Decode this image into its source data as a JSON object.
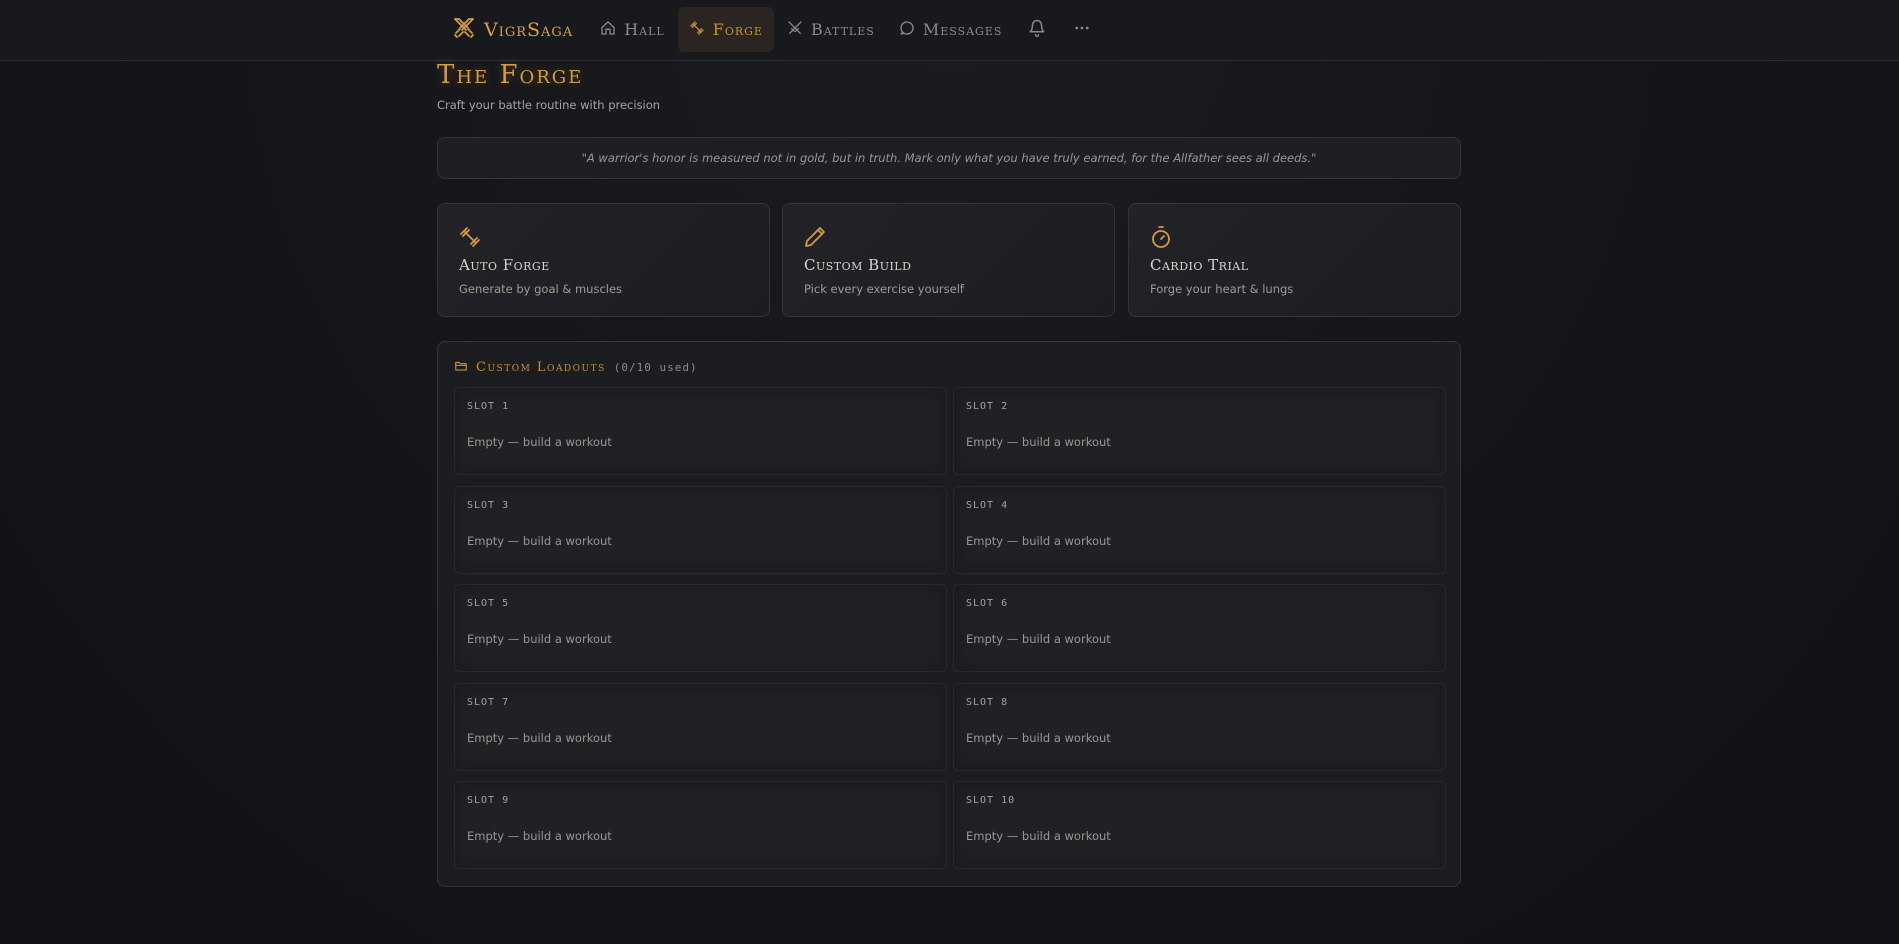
{
  "nav": {
    "brand": "VigrSaga",
    "items": [
      {
        "label": "Hall",
        "icon": "home-icon"
      },
      {
        "label": "Forge",
        "icon": "dumbbell-icon",
        "active": true
      },
      {
        "label": "Battles",
        "icon": "crossed-swords-icon"
      },
      {
        "label": "Messages",
        "icon": "chat-bubble-icon"
      }
    ],
    "bell_icon": "bell-icon",
    "more_icon": "more-icon"
  },
  "page": {
    "title": "The Forge",
    "subtitle": "Craft your battle routine with precision",
    "quote": "\"A warrior's honor is measured not in gold, but in truth. Mark only what you have truly earned, for the Allfather sees all deeds.\""
  },
  "modes": [
    {
      "title": "Auto Forge",
      "description": "Generate by goal & muscles",
      "icon": "dumbbell-icon"
    },
    {
      "title": "Custom Build",
      "description": "Pick every exercise yourself",
      "icon": "pencil-icon"
    },
    {
      "title": "Cardio Trial",
      "description": "Forge your heart & lungs",
      "icon": "stopwatch-icon"
    }
  ],
  "loadouts": {
    "title": "Custom Loadouts",
    "count": "(0/10 used)",
    "icon": "folder-icon",
    "slots": [
      {
        "label": "SLOT 1",
        "status": "Empty — build a workout"
      },
      {
        "label": "SLOT 2",
        "status": "Empty — build a workout"
      },
      {
        "label": "SLOT 3",
        "status": "Empty — build a workout"
      },
      {
        "label": "SLOT 4",
        "status": "Empty — build a workout"
      },
      {
        "label": "SLOT 5",
        "status": "Empty — build a workout"
      },
      {
        "label": "SLOT 6",
        "status": "Empty — build a workout"
      },
      {
        "label": "SLOT 7",
        "status": "Empty — build a workout"
      },
      {
        "label": "SLOT 8",
        "status": "Empty — build a workout"
      },
      {
        "label": "SLOT 9",
        "status": "Empty — build a workout"
      },
      {
        "label": "SLOT 10",
        "status": "Empty — build a workout"
      }
    ]
  },
  "colors": {
    "accent": "#d59a45",
    "background": "#131418",
    "card": "#1e1f23"
  }
}
